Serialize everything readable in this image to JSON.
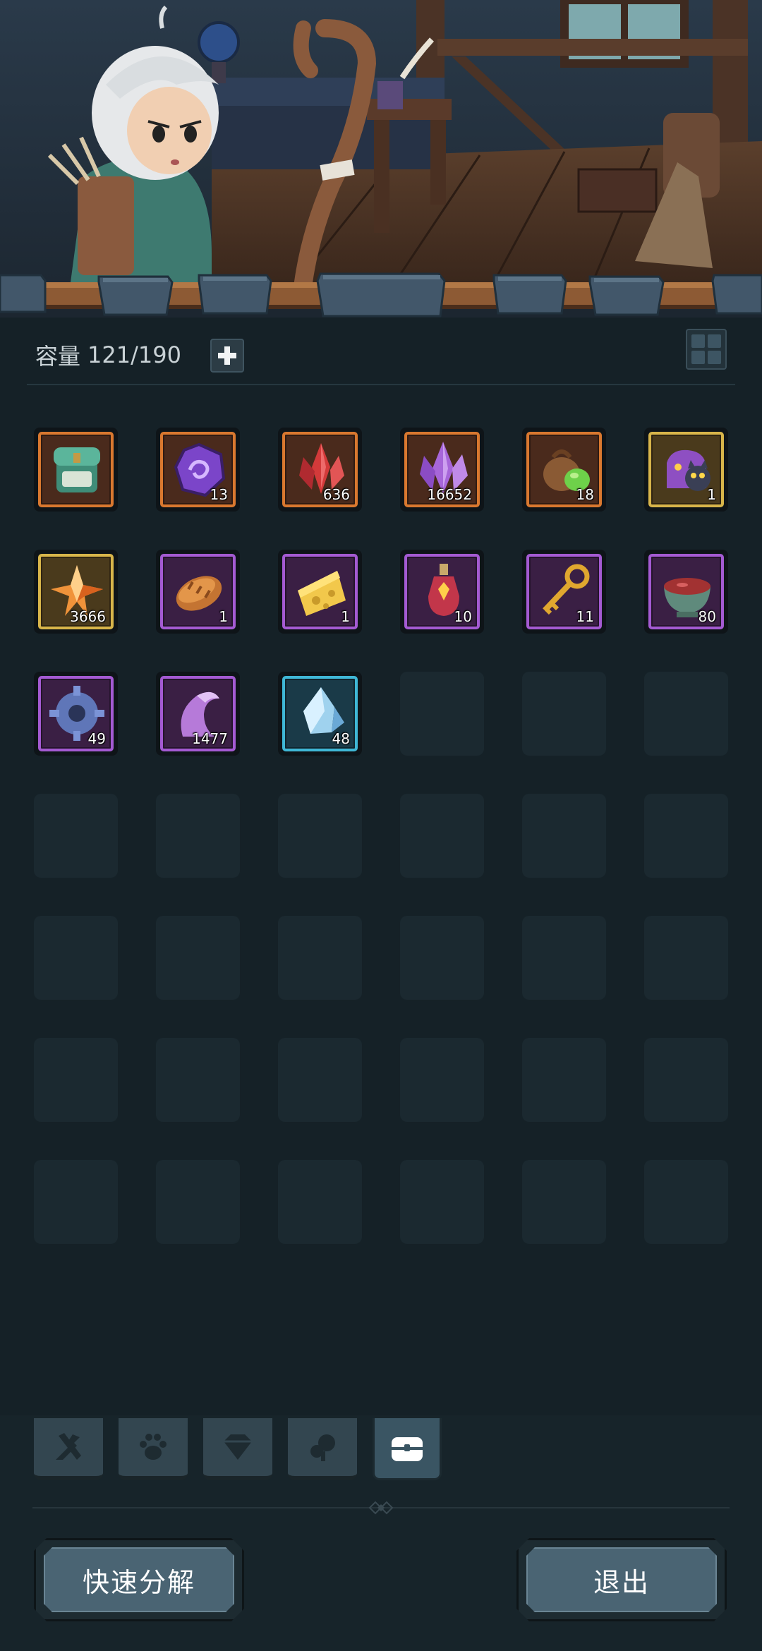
{
  "header": {
    "capacity_label": "容量",
    "capacity_value": "121/190"
  },
  "inventory": {
    "items": [
      {
        "icon": "green-backpack-icon",
        "rarity": "orange",
        "count": ""
      },
      {
        "icon": "purple-rune-stone-icon",
        "rarity": "orange",
        "count": "13"
      },
      {
        "icon": "red-crystal-icon",
        "rarity": "orange",
        "count": "636"
      },
      {
        "icon": "purple-crystal-icon",
        "rarity": "orange",
        "count": "16652"
      },
      {
        "icon": "seed-pouch-icon",
        "rarity": "orange",
        "count": "18"
      },
      {
        "icon": "cat-gift-bag-icon",
        "rarity": "gold",
        "count": "1"
      },
      {
        "icon": "orange-star-crystal-icon",
        "rarity": "gold",
        "count": "3666"
      },
      {
        "icon": "bread-icon",
        "rarity": "purple",
        "count": "1"
      },
      {
        "icon": "cheese-icon",
        "rarity": "purple",
        "count": "1"
      },
      {
        "icon": "red-potion-icon",
        "rarity": "purple",
        "count": "10"
      },
      {
        "icon": "golden-key-icon",
        "rarity": "purple",
        "count": "11"
      },
      {
        "icon": "soup-bowl-icon",
        "rarity": "purple",
        "count": "80"
      },
      {
        "icon": "blue-gear-ore-icon",
        "rarity": "purple",
        "count": "49"
      },
      {
        "icon": "purple-horn-icon",
        "rarity": "purple",
        "count": "1477"
      },
      {
        "icon": "blue-ice-crystal-icon",
        "rarity": "blue",
        "count": "48"
      }
    ],
    "total_slots": 42
  },
  "rarity_colors": {
    "orange": "#d9782f",
    "gold": "#d8b54a",
    "purple": "#a45ad2",
    "blue": "#3fb7d6"
  },
  "tabs": [
    {
      "icon": "weapon-tools-icon",
      "active": false
    },
    {
      "icon": "paw-icon",
      "active": false
    },
    {
      "icon": "gem-icon",
      "active": false
    },
    {
      "icon": "shards-icon",
      "active": false
    },
    {
      "icon": "treasure-chest-icon",
      "active": true
    }
  ],
  "buttons": {
    "quick_decompose": "快速分解",
    "exit": "退出"
  }
}
